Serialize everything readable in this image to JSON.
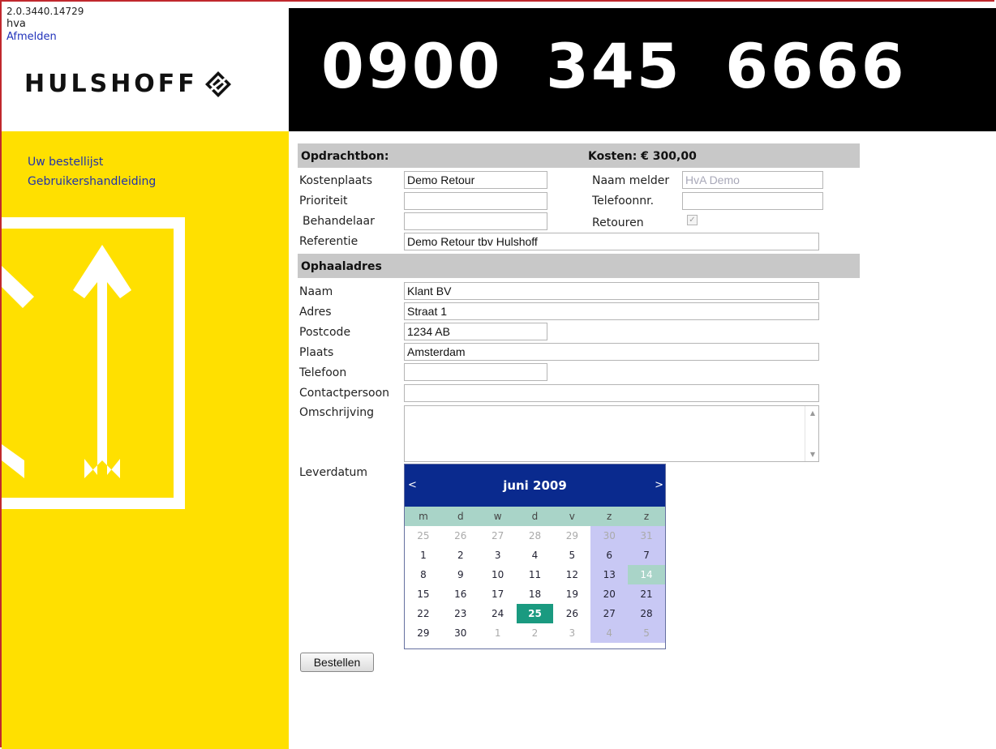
{
  "sidebar": {
    "version": "2.0.3440.14729",
    "user": "hva",
    "logout": "Afmelden",
    "logo": "HULSHOFF",
    "nav": [
      "Uw bestellijst",
      "Gebruikershandleiding"
    ]
  },
  "header": {
    "phone": "0900 345 6666"
  },
  "order": {
    "title": "Opdrachtbon:",
    "cost": "Kosten: € 300,00",
    "fields": {
      "kostenplaats": {
        "label": "Kostenplaats",
        "value": "Demo Retour"
      },
      "prioriteit": {
        "label": "Prioriteit",
        "value": ""
      },
      "behandelaar": {
        "label": "Behandelaar",
        "value": ""
      },
      "referentie": {
        "label": "Referentie",
        "value": "Demo Retour tbv Hulshoff"
      },
      "naam_melder": {
        "label": "Naam melder",
        "value": "HvA Demo"
      },
      "telefoonnr": {
        "label": "Telefoonnr.",
        "value": ""
      },
      "retouren": {
        "label": "Retouren",
        "checked": true
      }
    }
  },
  "pickup": {
    "title": "Ophaaladres",
    "fields": {
      "naam": {
        "label": "Naam",
        "value": "Klant BV"
      },
      "adres": {
        "label": "Adres",
        "value": "Straat 1"
      },
      "postcode": {
        "label": "Postcode",
        "value": "1234 AB"
      },
      "plaats": {
        "label": "Plaats",
        "value": "Amsterdam"
      },
      "telefoon": {
        "label": "Telefoon",
        "value": ""
      },
      "contactpersoon": {
        "label": "Contactpersoon",
        "value": ""
      },
      "omschrijving": {
        "label": "Omschrijving",
        "value": ""
      },
      "leverdatum": {
        "label": "Leverdatum"
      }
    }
  },
  "calendar": {
    "prev": "<",
    "next": ">",
    "title": "juni 2009",
    "weekdays": [
      "m",
      "d",
      "w",
      "d",
      "v",
      "z",
      "z"
    ],
    "days": [
      {
        "d": "25",
        "o": true
      },
      {
        "d": "26",
        "o": true
      },
      {
        "d": "27",
        "o": true
      },
      {
        "d": "28",
        "o": true
      },
      {
        "d": "29",
        "o": true
      },
      {
        "d": "30",
        "o": true
      },
      {
        "d": "31",
        "o": true
      },
      {
        "d": "1"
      },
      {
        "d": "2"
      },
      {
        "d": "3"
      },
      {
        "d": "4"
      },
      {
        "d": "5"
      },
      {
        "d": "6"
      },
      {
        "d": "7"
      },
      {
        "d": "8"
      },
      {
        "d": "9"
      },
      {
        "d": "10"
      },
      {
        "d": "11"
      },
      {
        "d": "12"
      },
      {
        "d": "13"
      },
      {
        "d": "14",
        "hl": true
      },
      {
        "d": "15"
      },
      {
        "d": "16"
      },
      {
        "d": "17"
      },
      {
        "d": "18"
      },
      {
        "d": "19"
      },
      {
        "d": "20"
      },
      {
        "d": "21"
      },
      {
        "d": "22"
      },
      {
        "d": "23"
      },
      {
        "d": "24"
      },
      {
        "d": "25",
        "sel": true
      },
      {
        "d": "26"
      },
      {
        "d": "27"
      },
      {
        "d": "28"
      },
      {
        "d": "29"
      },
      {
        "d": "30"
      },
      {
        "d": "1",
        "o": true
      },
      {
        "d": "2",
        "o": true
      },
      {
        "d": "3",
        "o": true
      },
      {
        "d": "4",
        "o": true
      },
      {
        "d": "5",
        "o": true
      }
    ]
  },
  "actions": {
    "submit": "Bestellen"
  },
  "colors": {
    "sidebar": "#ffe000",
    "banner": "#000000",
    "calendar_header": "#0a2a8e",
    "selected_day": "#1a9a80"
  }
}
